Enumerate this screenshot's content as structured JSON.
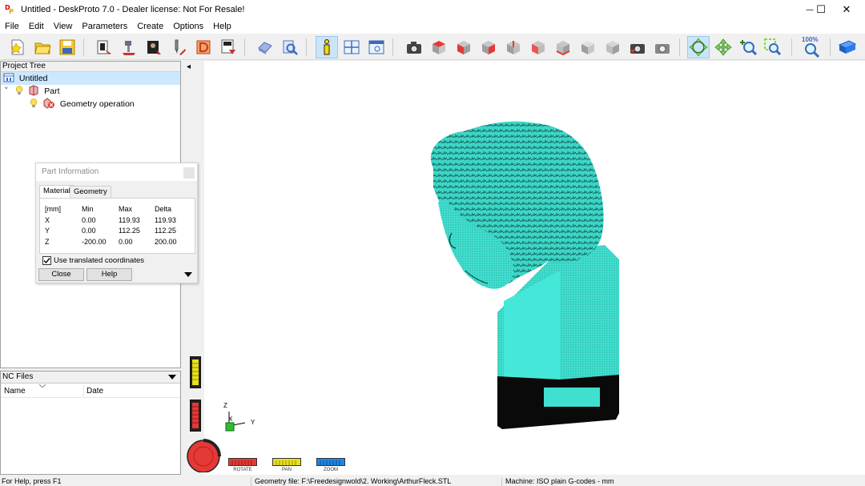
{
  "window": {
    "title": "Untitled - DeskProto 7.0 - Dealer license: Not For Resale!",
    "app_icon_letters": [
      "D",
      "P"
    ],
    "minimize_glyph": "—",
    "maximize_glyph": "☐",
    "close_glyph": "✕"
  },
  "menu": [
    "File",
    "Edit",
    "View",
    "Parameters",
    "Create",
    "Options",
    "Help"
  ],
  "toolbar": {
    "zoom_label": "100%",
    "groups": [
      "file",
      "wizards",
      "info",
      "views",
      "zoom",
      "help"
    ]
  },
  "project_tree": {
    "header": "Project Tree",
    "root": "Untitled",
    "part": "Part",
    "operation": "Geometry operation",
    "expand_glyph": "˅"
  },
  "part_info": {
    "title": "Part Information",
    "tabs": [
      "Material",
      "Geometry"
    ],
    "headers": [
      "[mm]",
      "Min",
      "Max",
      "Delta"
    ],
    "rows": [
      {
        "axis": "X",
        "min": "0.00",
        "max": "119.93",
        "delta": "119.93"
      },
      {
        "axis": "Y",
        "min": "0.00",
        "max": "112.25",
        "delta": "112.25"
      },
      {
        "axis": "Z",
        "min": "-200.00",
        "max": "0.00",
        "delta": "200.00"
      }
    ],
    "checkbox_label": "Use translated coordinates",
    "checkbox_checked": true,
    "close_label": "Close",
    "help_label": "Help"
  },
  "nc_files": {
    "header": "NC Files",
    "columns": [
      "Name",
      "Date"
    ]
  },
  "viewport": {
    "model_color": "#40e0d0",
    "axis_labels": {
      "z": "Z",
      "x": "X",
      "y": "Y"
    },
    "collapse_glyph": "◂"
  },
  "mouse_modes": {
    "rotate": "ROTATE",
    "pan": "PAN",
    "zoom": "ZOOM"
  },
  "status": {
    "help": "For Help, press F1",
    "geometry_file": "Geometry file: F:\\Freedesignwold\\2. Working\\ArthurFleck.STL",
    "machine": "Machine: ISO plain G-codes - mm"
  }
}
